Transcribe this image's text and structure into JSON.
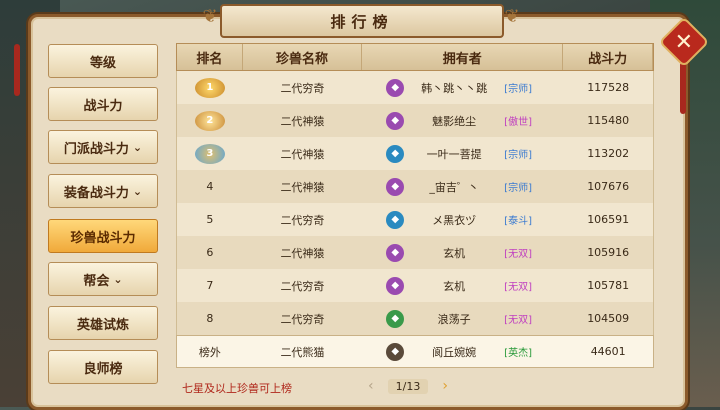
{
  "title": "排行榜",
  "close_icon": "close-icon",
  "tabs": [
    {
      "label": "等级",
      "chevron": false,
      "active": false
    },
    {
      "label": "战斗力",
      "chevron": false,
      "active": false
    },
    {
      "label": "门派战斗力",
      "chevron": true,
      "active": false
    },
    {
      "label": "装备战斗力",
      "chevron": true,
      "active": false
    },
    {
      "label": "珍兽战斗力",
      "chevron": false,
      "active": true
    },
    {
      "label": "帮会",
      "chevron": true,
      "active": false
    },
    {
      "label": "英雄试炼",
      "chevron": false,
      "active": false
    },
    {
      "label": "良师榜",
      "chevron": false,
      "active": false
    }
  ],
  "columns": {
    "rank": "排名",
    "pet": "珍兽名称",
    "owner": "拥有者",
    "power": "战斗力"
  },
  "rows": [
    {
      "rank": "1",
      "medal": "gold",
      "pet": "二代穷奇",
      "owner": "韩丶跳丶丶跳",
      "icon": "purple",
      "tag": "[宗师]",
      "tag_color": "#3a7ad0",
      "power": "117528"
    },
    {
      "rank": "2",
      "medal": "silver",
      "pet": "二代神猿",
      "owner": "魅影绝尘",
      "icon": "purple",
      "tag": "[傲世]",
      "tag_color": "#c040c0",
      "power": "115480"
    },
    {
      "rank": "3",
      "medal": "blue",
      "pet": "二代神猿",
      "owner": "一叶一菩提",
      "icon": "blue",
      "tag": "[宗师]",
      "tag_color": "#3a7ad0",
      "power": "113202"
    },
    {
      "rank": "4",
      "medal": "",
      "pet": "二代神猿",
      "owner": "_宙吉゜丶",
      "icon": "purple",
      "tag": "[宗师]",
      "tag_color": "#3a7ad0",
      "power": "107676"
    },
    {
      "rank": "5",
      "medal": "",
      "pet": "二代穷奇",
      "owner": "メ黑衣ヅ",
      "icon": "blue",
      "tag": "[泰斗]",
      "tag_color": "#3a7ad0",
      "power": "106591"
    },
    {
      "rank": "6",
      "medal": "",
      "pet": "二代神猿",
      "owner": "玄机",
      "icon": "purple",
      "tag": "[无双]",
      "tag_color": "#c040c0",
      "power": "105916"
    },
    {
      "rank": "7",
      "medal": "",
      "pet": "二代穷奇",
      "owner": "玄机",
      "icon": "purple",
      "tag": "[无双]",
      "tag_color": "#c040c0",
      "power": "105781"
    },
    {
      "rank": "8",
      "medal": "",
      "pet": "二代穷奇",
      "owner": "浪荡子",
      "icon": "green",
      "tag": "[无双]",
      "tag_color": "#c040c0",
      "power": "104509"
    }
  ],
  "self_row": {
    "rank": "榜外",
    "pet": "二代熊猫",
    "owner": "阆丘婉婉",
    "icon": "dark",
    "tag": "[英杰]",
    "tag_color": "#2a9a3a",
    "power": "44601"
  },
  "footer_note": "七星及以上珍兽可上榜",
  "pager": {
    "page": "1/13"
  }
}
